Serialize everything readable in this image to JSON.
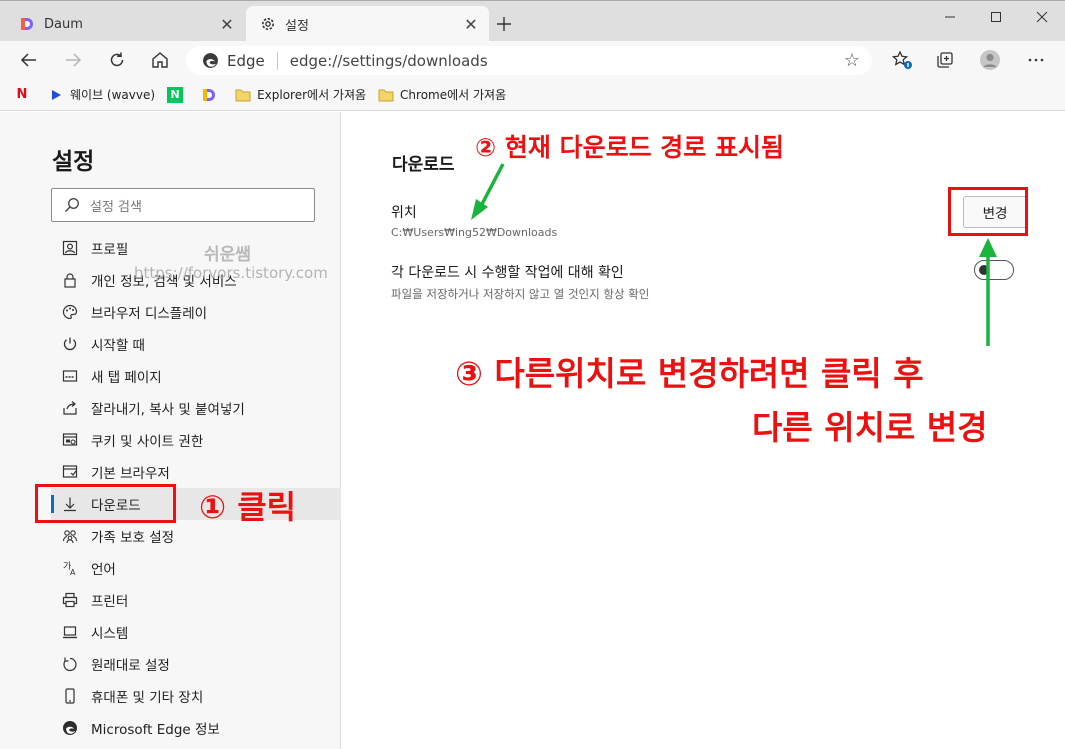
{
  "tabs": [
    {
      "title": "Daum",
      "active": false,
      "favicon": "daum-logo-icon"
    },
    {
      "title": "설정",
      "active": true,
      "favicon": "gear-icon"
    }
  ],
  "address": {
    "site": "Edge",
    "url": "edge://settings/downloads"
  },
  "bookmarks": [
    {
      "label": "",
      "icon": "netflix-icon"
    },
    {
      "label": "웨이브 (wavve)",
      "icon": "wavve-icon"
    },
    {
      "label": "",
      "icon": "naver-icon"
    },
    {
      "label": "",
      "icon": "daum-logo-icon"
    },
    {
      "label": "Explorer에서 가져옴",
      "icon": "folder-icon"
    },
    {
      "label": "Chrome에서 가져옴",
      "icon": "folder-icon"
    }
  ],
  "sidebar": {
    "title": "설정",
    "search_placeholder": "설정 검색",
    "items": [
      {
        "label": "프로필",
        "icon": "profile-icon"
      },
      {
        "label": "개인 정보, 검색 및 서비스",
        "icon": "lock-icon"
      },
      {
        "label": "브라우저 디스플레이",
        "icon": "palette-icon"
      },
      {
        "label": "시작할 때",
        "icon": "power-icon"
      },
      {
        "label": "새 탭 페이지",
        "icon": "new-tab-icon"
      },
      {
        "label": "잘라내기, 복사 및 붙여넣기",
        "icon": "share-icon"
      },
      {
        "label": "쿠키 및 사이트 권한",
        "icon": "site-permissions-icon"
      },
      {
        "label": "기본 브라우저",
        "icon": "default-browser-icon"
      },
      {
        "label": "다운로드",
        "icon": "download-icon",
        "active": true
      },
      {
        "label": "가족 보호 설정",
        "icon": "family-icon"
      },
      {
        "label": "언어",
        "icon": "language-icon"
      },
      {
        "label": "프린터",
        "icon": "printer-icon"
      },
      {
        "label": "시스템",
        "icon": "system-icon"
      },
      {
        "label": "원래대로 설정",
        "icon": "reset-icon"
      },
      {
        "label": "휴대폰 및 기타 장치",
        "icon": "phone-icon"
      },
      {
        "label": "Microsoft Edge 정보",
        "icon": "edge-icon"
      }
    ]
  },
  "watermark": {
    "name": "쉬운쌤",
    "url": "https://forvors.tistory.com"
  },
  "downloads": {
    "title": "다운로드",
    "location_label": "위치",
    "location_path": "C:₩Users₩ing52₩Downloads",
    "change_label": "변경",
    "ask_label": "각 다운로드 시 수행할 작업에 대해 확인",
    "ask_desc": "파일을 저장하거나 저장하지 않고 열 것인지 항상 확인",
    "ask_enabled": false
  },
  "annotations": {
    "step1": "① 클릭",
    "step2": "② 현재 다운로드 경로 표시됨",
    "step3_line1": "③ 다른위치로 변경하려면 클릭 후",
    "step3_line2": "다른 위치로 변경"
  },
  "colors": {
    "accent": "#0f6cbd",
    "annotation_red": "#ec1111",
    "annotation_green": "#19b43c"
  }
}
